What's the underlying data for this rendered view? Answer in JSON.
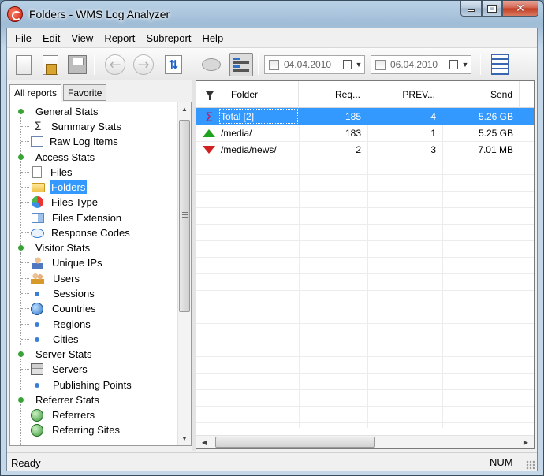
{
  "window": {
    "title": "Folders - WMS Log Analyzer"
  },
  "menu": [
    "File",
    "Edit",
    "View",
    "Report",
    "Subreport",
    "Help"
  ],
  "toolbar": {
    "date_from": "04.04.2010",
    "date_to": "06.04.2010"
  },
  "tabs": [
    "All reports",
    "Favorite"
  ],
  "tree": [
    {
      "label": "General Stats",
      "icon": "green-dot-icon",
      "level": 0
    },
    {
      "label": "Summary Stats",
      "icon": "sigma-icon",
      "level": 1
    },
    {
      "label": "Raw Log Items",
      "icon": "grid-icon",
      "level": 1
    },
    {
      "label": "Access Stats",
      "icon": "green-dot-icon",
      "level": 0
    },
    {
      "label": "Files",
      "icon": "file-icon",
      "level": 1
    },
    {
      "label": "Folders",
      "icon": "folder-icon",
      "level": 1,
      "selected": true
    },
    {
      "label": "Files Type",
      "icon": "pie-icon",
      "level": 1
    },
    {
      "label": "Files Extension",
      "icon": "extension-icon",
      "level": 1
    },
    {
      "label": "Response Codes",
      "icon": "bubble-icon",
      "level": 1
    },
    {
      "label": "Visitor Stats",
      "icon": "green-dot-icon",
      "level": 0
    },
    {
      "label": "Unique IPs",
      "icon": "person-icon",
      "level": 1
    },
    {
      "label": "Users",
      "icon": "users-icon",
      "level": 1
    },
    {
      "label": "Sessions",
      "icon": "blue-dot-icon",
      "level": 1
    },
    {
      "label": "Countries",
      "icon": "globe-icon",
      "level": 1
    },
    {
      "label": "Regions",
      "icon": "blue-dot-icon",
      "level": 1
    },
    {
      "label": "Cities",
      "icon": "blue-dot-icon",
      "level": 1
    },
    {
      "label": "Server Stats",
      "icon": "green-dot-icon",
      "level": 0
    },
    {
      "label": "Servers",
      "icon": "server-icon",
      "level": 1
    },
    {
      "label": "Publishing Points",
      "icon": "blue-dot-icon",
      "level": 1
    },
    {
      "label": "Referrer Stats",
      "icon": "green-dot-icon",
      "level": 0
    },
    {
      "label": "Referrers",
      "icon": "globe-green-icon",
      "level": 1
    },
    {
      "label": "Referring Sites",
      "icon": "globe-green-icon",
      "level": 1
    }
  ],
  "grid": {
    "columns": [
      "Folder",
      "Req...",
      "PREV...",
      "Send"
    ],
    "rows": [
      {
        "icon": "sigma-icon",
        "folder": "Total [2]",
        "req": "185",
        "prev": "4",
        "send": "5.26 GB",
        "selected": true
      },
      {
        "icon": "arrow-up-icon",
        "folder": "/media/",
        "req": "183",
        "prev": "1",
        "send": "5.25 GB"
      },
      {
        "icon": "arrow-down-icon",
        "folder": "/media/news/",
        "req": "2",
        "prev": "3",
        "send": "7.01 MB"
      }
    ]
  },
  "status": {
    "text": "Ready",
    "num": "NUM"
  }
}
